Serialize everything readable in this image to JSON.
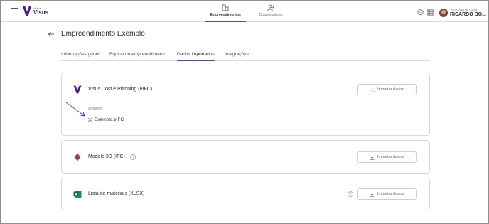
{
  "app": {
    "brand_small": "Virtual",
    "brand_name": "Visus",
    "accent_color": "#6a3fb6"
  },
  "nav": {
    "tabs": [
      {
        "label": "Empreendimentos",
        "icon": "buildings-icon",
        "active": true
      },
      {
        "label": "Colaboradores",
        "icon": "people-icon",
        "active": false
      }
    ]
  },
  "user": {
    "greeting": "Você está na conta",
    "name": "RICARDO BO..."
  },
  "page": {
    "title": "Empreendimento Exemplo",
    "tabs": [
      {
        "label": "Informações gerais",
        "active": false
      },
      {
        "label": "Equipe do empreendimento",
        "active": false
      },
      {
        "label": "Dados importados",
        "active": true
      },
      {
        "label": "Integrações",
        "active": false
      }
    ]
  },
  "cards": [
    {
      "title": "Visus Cost e Planning (eIFC)",
      "icon": "visus-logo-icon",
      "button": "Importar dados",
      "files_label": "Arquivos",
      "files": [
        "Exemplo.eIFC"
      ]
    },
    {
      "title": "Modelo 3D (IFC)",
      "icon": "ifc-logo-icon",
      "help": true,
      "button": "Importar dados"
    },
    {
      "title": "Lista de materiais (XLSX)",
      "icon": "excel-icon",
      "help": true,
      "button": "Importar dados"
    }
  ]
}
